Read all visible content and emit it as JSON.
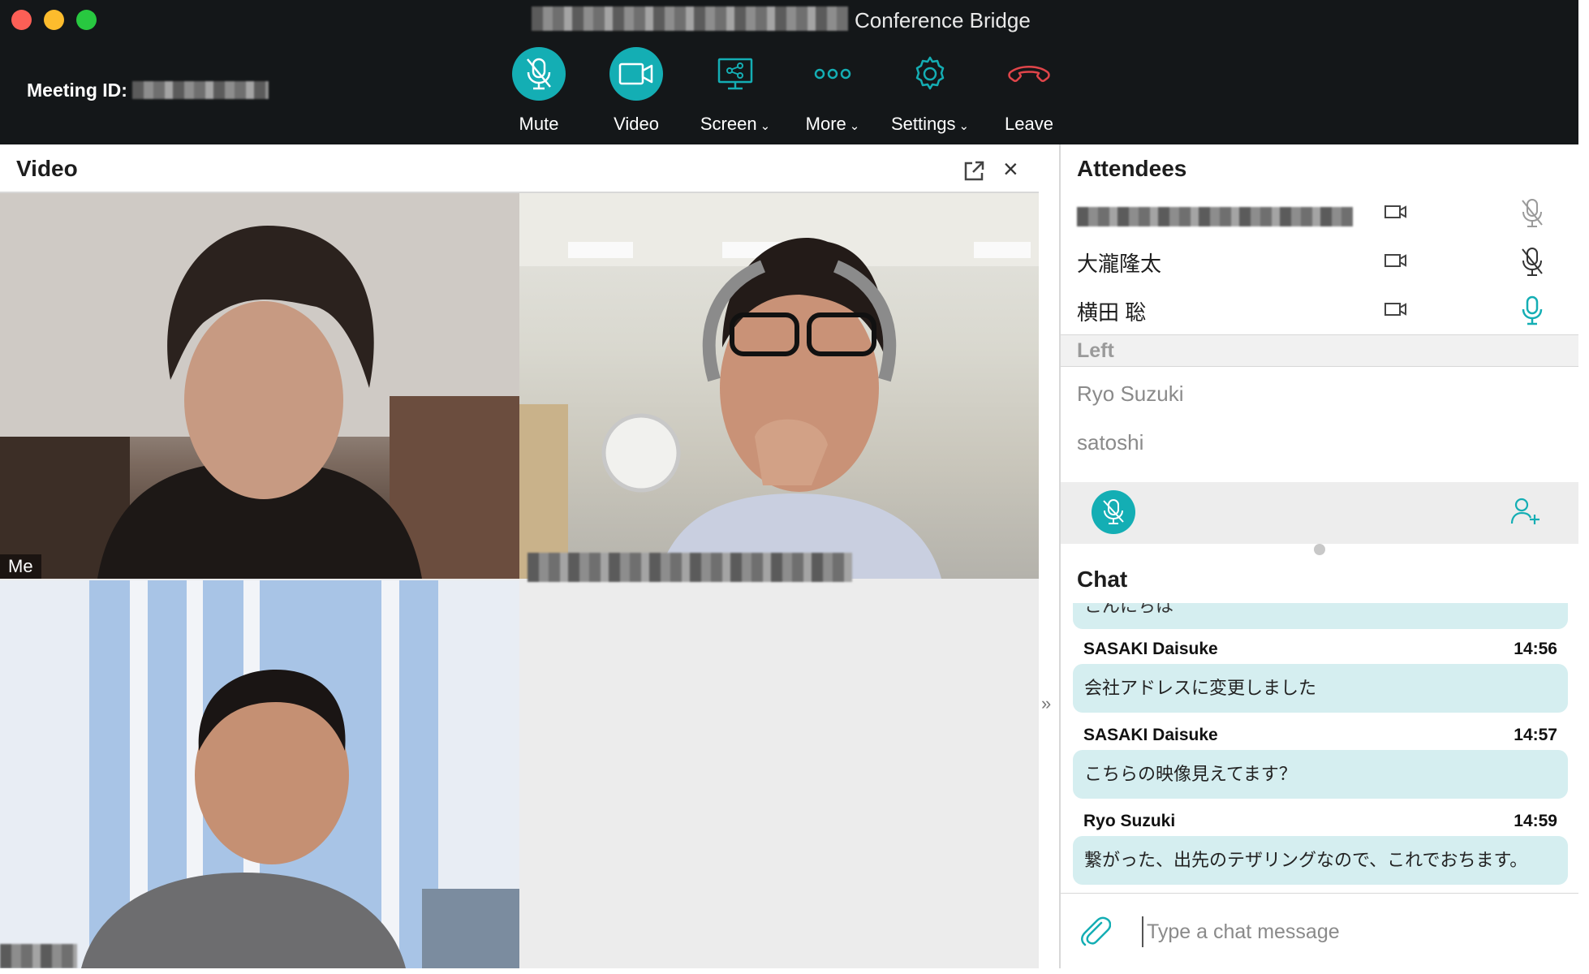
{
  "window": {
    "title": "Conference Bridge"
  },
  "meeting": {
    "label": "Meeting ID:"
  },
  "toolbar": {
    "mute": "Mute",
    "video": "Video",
    "screen": "Screen",
    "more": "More",
    "settings": "Settings",
    "leave": "Leave",
    "caret": "⌄"
  },
  "video_panel": {
    "title": "Video",
    "close": "×",
    "tiles": [
      {
        "name": "Me"
      }
    ]
  },
  "attendees": {
    "title": "Attendees",
    "list": [
      {
        "name": "",
        "mic": "muted"
      },
      {
        "name": "大瀧隆太",
        "mic": "muted"
      },
      {
        "name": "横田 聡",
        "mic": "active"
      }
    ],
    "left_header": "Left",
    "left": [
      "Ryo Suzuki",
      "satoshi"
    ]
  },
  "chat": {
    "title": "Chat",
    "partial": "こんにちは",
    "messages": [
      {
        "author": "SASAKI Daisuke",
        "time": "14:56",
        "text": "会社アドレスに変更しました"
      },
      {
        "author": "SASAKI Daisuke",
        "time": "14:57",
        "text": "こちらの映像見えてます？"
      },
      {
        "author": "Ryo Suzuki",
        "time": "14:59",
        "text": "繋がった、出先のテザリングなので、これでおちます。"
      }
    ],
    "placeholder": "Type a chat message"
  },
  "colors": {
    "accent": "#14aeb4",
    "leave": "#e0454a",
    "topbar": "#141719",
    "bubble": "#d5eef0"
  },
  "icons": [
    "mic-muted-icon",
    "video-camera-icon",
    "screen-share-icon",
    "more-dots-icon",
    "gear-icon",
    "phone-hangup-icon",
    "popout-icon",
    "close-icon",
    "camera-icon",
    "add-user-icon",
    "paperclip-icon"
  ]
}
